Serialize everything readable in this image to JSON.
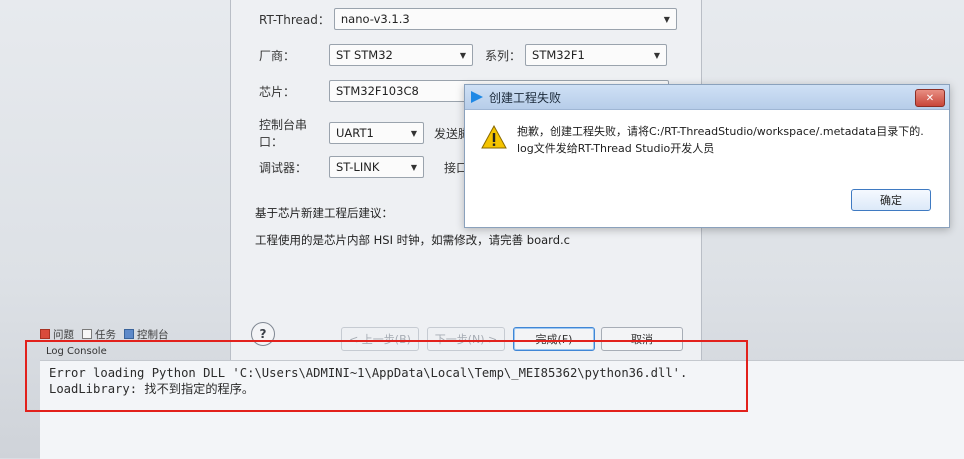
{
  "wizard": {
    "rtthread": {
      "label": "RT-Thread：",
      "value": "nano-v3.1.3"
    },
    "vendor": {
      "label": "厂商：",
      "value": "ST STM32"
    },
    "series": {
      "label": "系列：",
      "value": "STM32F1"
    },
    "chip": {
      "label": "芯片：",
      "value": "STM32F103C8"
    },
    "console_port": {
      "label": "控制台串口：",
      "value": "UART1"
    },
    "send_pin_label": "发送脚",
    "debugger": {
      "label": "调试器：",
      "value": "ST-LINK"
    },
    "interface_label": "接口",
    "advice_title": "基于芯片新建工程后建议：",
    "advice_text": "工程使用的是芯片内部 HSI 时钟，如需修改，请完善 board.c",
    "buttons": {
      "help": "?",
      "back": "< 上一步(B)",
      "next": "下一步(N) >",
      "finish": "完成(F)",
      "cancel": "取消"
    }
  },
  "error_dialog": {
    "title": "创建工程失败",
    "message_line1": "抱歉，创建工程失败，请将C:/RT-ThreadStudio/workspace/.metadata目录下的.",
    "message_line2": "log文件发给RT-Thread Studio开发人员",
    "ok": "确定",
    "close": "✕"
  },
  "bottom_tabs": [
    {
      "label": "问题",
      "icon": "problems-icon"
    },
    {
      "label": "任务",
      "icon": "tasks-icon"
    },
    {
      "label": "控制台",
      "icon": "console-icon"
    }
  ],
  "console": {
    "title": "Log Console",
    "line1": "Error loading Python DLL 'C:\\Users\\ADMINI~1\\AppData\\Local\\Temp\\_MEI85362\\python36.dll'.",
    "line2": "LoadLibrary: 找不到指定的程序。"
  },
  "colors": {
    "highlight": "#e2211c",
    "title_bar": "#b7cde9"
  }
}
